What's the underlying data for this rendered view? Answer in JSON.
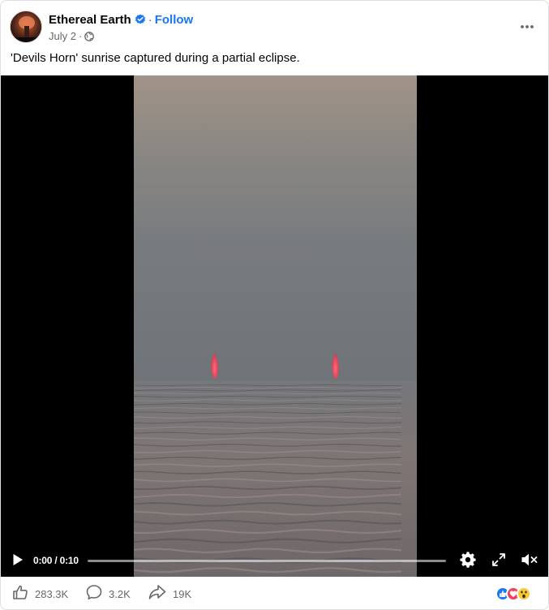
{
  "post": {
    "page_name": "Ethereal Earth",
    "follow_label": "Follow",
    "separator": "·",
    "date": "July 2",
    "date_separator": "·",
    "caption": "'Devils Horn' sunrise captured during a partial eclipse.",
    "icons": {
      "verified": "verified-badge-icon",
      "audience": "globe-icon",
      "more": "more-options-icon"
    },
    "accent_color": "#1877f2"
  },
  "video": {
    "time_display": "0:00 / 0:10",
    "progress": 0.0,
    "icons": {
      "play": "play-icon",
      "settings": "gear-icon",
      "fullscreen": "expand-icon",
      "mute": "muted-speaker-icon"
    }
  },
  "engagement": {
    "likes": "283.3K",
    "comments": "3.2K",
    "shares": "19K",
    "icons": {
      "like": "thumbs-up-icon",
      "comment": "comment-bubble-icon",
      "share": "share-arrow-icon"
    },
    "reactions": [
      "like-reaction-icon",
      "love-reaction-icon",
      "wow-reaction-icon"
    ]
  }
}
